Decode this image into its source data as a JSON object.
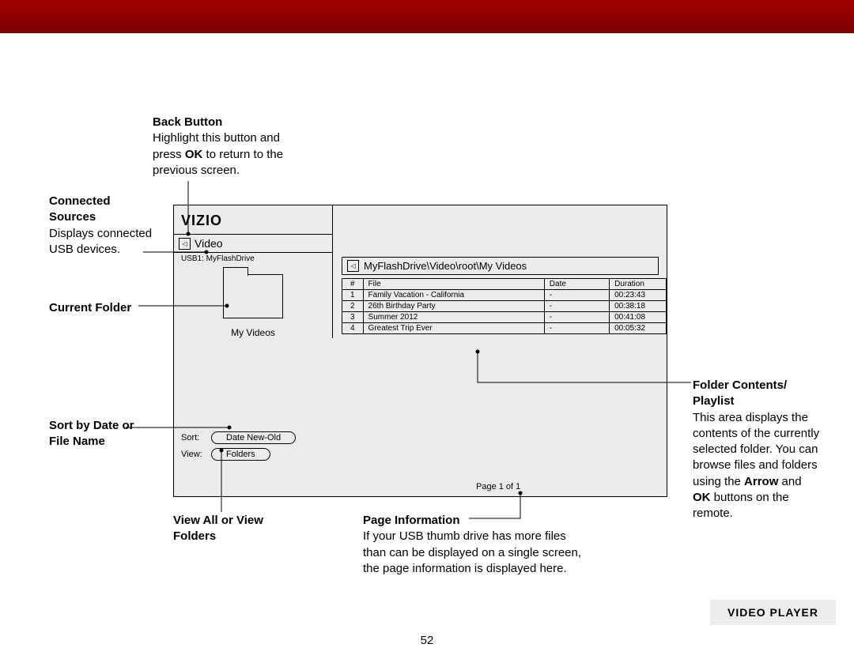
{
  "header_bar": {
    "color": "#8c0000"
  },
  "callouts": {
    "back_button": {
      "title": "Back Button",
      "body_prefix": "Highlight this button and press ",
      "ok": "OK",
      "body_suffix": " to return to the previous screen."
    },
    "connected_sources": {
      "title": "Connected Sources",
      "body": "Displays connected USB devices."
    },
    "current_folder": {
      "title": "Current Folder"
    },
    "sort": {
      "title": "Sort by Date or File Name"
    },
    "view": {
      "title": "View All or View Folders"
    },
    "page_info": {
      "title": "Page Information",
      "body": "If your USB thumb drive has more files than can be displayed on a single screen, the page information is displayed here."
    },
    "folder_contents": {
      "title": "Folder Contents/ Playlist",
      "body_prefix": "This area displays the contents of the currently selected folder. You can browse files and folders using the ",
      "arrow": "Arrow",
      "and": " and ",
      "ok": "OK",
      "body_suffix": " buttons on the remote."
    }
  },
  "device": {
    "logo": "VIZIO",
    "tab": "Video",
    "usb_label": "USB1: MyFlashDrive",
    "folder_name": "My Videos",
    "sort_label": "Sort:",
    "sort_value": "Date New-Old",
    "view_label": "View:",
    "view_value": "Folders",
    "breadcrumb": "MyFlashDrive\\Video\\root\\My Videos",
    "table_headers": {
      "num": "#",
      "file": "File",
      "date": "Date",
      "duration": "Duration"
    },
    "table_rows": [
      {
        "num": "1",
        "file": "Family Vacation - California",
        "date": "-",
        "duration": "00:23:43"
      },
      {
        "num": "2",
        "file": "26th Birthday Party",
        "date": "-",
        "duration": "00:38:18"
      },
      {
        "num": "3",
        "file": "Summer 2012",
        "date": "-",
        "duration": "00:41:08"
      },
      {
        "num": "4",
        "file": "Greatest Trip Ever",
        "date": "-",
        "duration": "00:05:32"
      }
    ],
    "page_info": "Page 1 of 1"
  },
  "footer": {
    "page_number": "52",
    "section_label": "VIDEO PLAYER"
  }
}
